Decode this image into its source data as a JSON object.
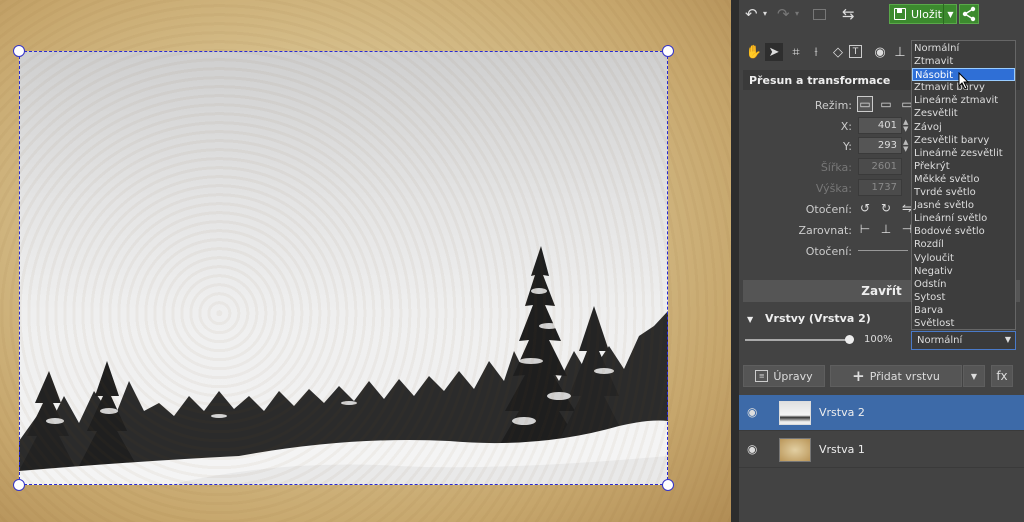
{
  "toolbar": {
    "save_label": "Uložit",
    "icons": [
      "undo-icon",
      "redo-icon",
      "image-icon",
      "flip-icon",
      "save-icon",
      "share-icon"
    ]
  },
  "tools": [
    "hand-icon",
    "pointer-icon",
    "crop-icon",
    "straighten-icon",
    "perspective-icon",
    "text-icon",
    "eye-icon",
    "clone-icon",
    "arrows-icon"
  ],
  "transform": {
    "title": "Přesun a transformace",
    "mode_label": "Režim:",
    "x_label": "X:",
    "x_value": "401",
    "y_label": "Y:",
    "y_value": "293",
    "width_label": "Šířka:",
    "width_value": "2601",
    "height_label": "Výška:",
    "height_value": "1737",
    "rotation_label": "Otočení:",
    "align_label": "Zarovnat:",
    "rotation2_label": "Otočení:",
    "close_label": "Zavřít"
  },
  "layers": {
    "title": "Vrstvy (Vrstva 2)",
    "opacity": "100%",
    "opacity_fraction": 1.0,
    "blend_mode": "Normální",
    "adjust_label": "Úpravy",
    "add_layer_label": "Přidat vrstvu",
    "fx_label": "fx",
    "items": [
      {
        "name": "Vrstva 2",
        "selected": true
      },
      {
        "name": "Vrstva 1",
        "selected": false
      }
    ]
  },
  "blend_menu": {
    "items": [
      "Normální",
      "Ztmavit",
      "Násobit",
      "Ztmavit barvy",
      "Lineárně ztmavit",
      "Zesvětlit",
      "Závoj",
      "Zesvětlit barvy",
      "Lineárně zesvětlit",
      "Překrýt",
      "Měkké světlo",
      "Tvrdé světlo",
      "Jasné světlo",
      "Lineární světlo",
      "Bodové světlo",
      "Rozdíl",
      "Vyloučit",
      "Negativ",
      "Odstín",
      "Sytost",
      "Barva",
      "Světlost"
    ],
    "highlighted": "Násobit"
  },
  "colors": {
    "accent_green": "#3c8a2e",
    "selection_blue": "#3d6aa8",
    "menu_highlight": "#2f6fd6"
  }
}
